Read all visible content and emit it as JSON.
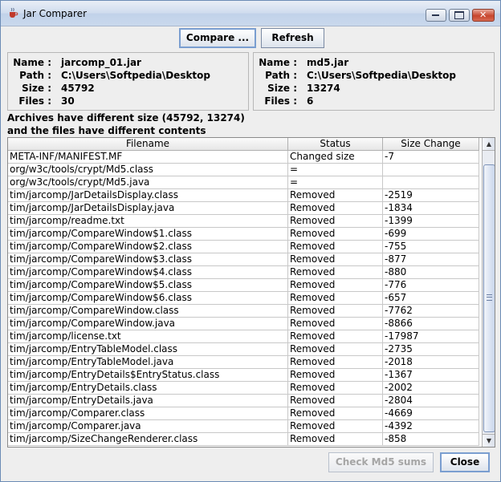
{
  "window": {
    "title": "Jar Comparer"
  },
  "toolbar": {
    "compare_label": "Compare ...",
    "refresh_label": "Refresh"
  },
  "left_archive": {
    "name_label": "Name :",
    "name": "jarcomp_01.jar",
    "path_label": "Path :",
    "path": "C:\\Users\\Softpedia\\Desktop",
    "size_label": "Size :",
    "size": "45792",
    "files_label": "Files :",
    "files": "30"
  },
  "right_archive": {
    "name_label": "Name :",
    "name": "md5.jar",
    "path_label": "Path :",
    "path": "C:\\Users\\Softpedia\\Desktop",
    "size_label": "Size :",
    "size": "13274",
    "files_label": "Files :",
    "files": "6"
  },
  "messages": {
    "line1": "Archives have different size (45792, 13274)",
    "line2": "and the files have different contents"
  },
  "table": {
    "headers": {
      "filename": "Filename",
      "status": "Status",
      "size_change": "Size Change"
    },
    "rows": [
      {
        "filename": "META-INF/MANIFEST.MF",
        "status": "Changed size",
        "size_change": "-7"
      },
      {
        "filename": "org/w3c/tools/crypt/Md5.class",
        "status": "=",
        "size_change": ""
      },
      {
        "filename": "org/w3c/tools/crypt/Md5.java",
        "status": "=",
        "size_change": ""
      },
      {
        "filename": "tim/jarcomp/JarDetailsDisplay.class",
        "status": "Removed",
        "size_change": "-2519"
      },
      {
        "filename": "tim/jarcomp/JarDetailsDisplay.java",
        "status": "Removed",
        "size_change": "-1834"
      },
      {
        "filename": "tim/jarcomp/readme.txt",
        "status": "Removed",
        "size_change": "-1399"
      },
      {
        "filename": "tim/jarcomp/CompareWindow$1.class",
        "status": "Removed",
        "size_change": "-699"
      },
      {
        "filename": "tim/jarcomp/CompareWindow$2.class",
        "status": "Removed",
        "size_change": "-755"
      },
      {
        "filename": "tim/jarcomp/CompareWindow$3.class",
        "status": "Removed",
        "size_change": "-877"
      },
      {
        "filename": "tim/jarcomp/CompareWindow$4.class",
        "status": "Removed",
        "size_change": "-880"
      },
      {
        "filename": "tim/jarcomp/CompareWindow$5.class",
        "status": "Removed",
        "size_change": "-776"
      },
      {
        "filename": "tim/jarcomp/CompareWindow$6.class",
        "status": "Removed",
        "size_change": "-657"
      },
      {
        "filename": "tim/jarcomp/CompareWindow.class",
        "status": "Removed",
        "size_change": "-7762"
      },
      {
        "filename": "tim/jarcomp/CompareWindow.java",
        "status": "Removed",
        "size_change": "-8866"
      },
      {
        "filename": "tim/jarcomp/license.txt",
        "status": "Removed",
        "size_change": "-17987"
      },
      {
        "filename": "tim/jarcomp/EntryTableModel.class",
        "status": "Removed",
        "size_change": "-2735"
      },
      {
        "filename": "tim/jarcomp/EntryTableModel.java",
        "status": "Removed",
        "size_change": "-2018"
      },
      {
        "filename": "tim/jarcomp/EntryDetails$EntryStatus.class",
        "status": "Removed",
        "size_change": "-1367"
      },
      {
        "filename": "tim/jarcomp/EntryDetails.class",
        "status": "Removed",
        "size_change": "-2002"
      },
      {
        "filename": "tim/jarcomp/EntryDetails.java",
        "status": "Removed",
        "size_change": "-2804"
      },
      {
        "filename": "tim/jarcomp/Comparer.class",
        "status": "Removed",
        "size_change": "-4669"
      },
      {
        "filename": "tim/jarcomp/Comparer.java",
        "status": "Removed",
        "size_change": "-4392"
      },
      {
        "filename": "tim/jarcomp/SizeChangeRenderer.class",
        "status": "Removed",
        "size_change": "-858"
      }
    ]
  },
  "footer": {
    "check_md5_label": "Check Md5 sums",
    "close_label": "Close"
  },
  "icons": {
    "title_icon": "java-cup-icon",
    "minimize": "minimize-icon",
    "maximize": "maximize-icon",
    "close": "close-icon",
    "scroll_up": "arrow-up-icon",
    "scroll_down": "arrow-down-icon"
  }
}
